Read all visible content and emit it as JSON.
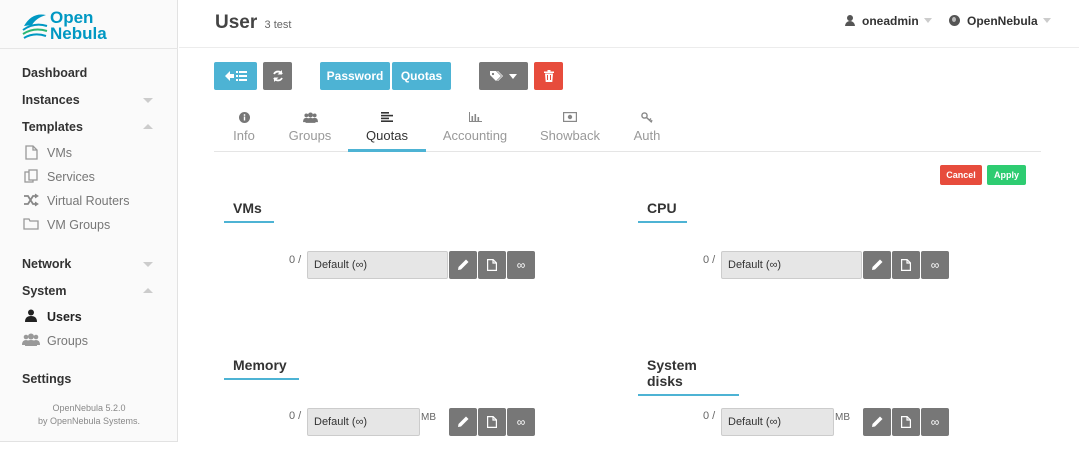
{
  "logo": {
    "line1": "Open",
    "line2": "Nebula"
  },
  "sidebar": {
    "dashboard": "Dashboard",
    "instances": "Instances",
    "templates": "Templates",
    "templates_items": [
      {
        "label": "VMs",
        "icon": "file-icon"
      },
      {
        "label": "Services",
        "icon": "services-icon"
      },
      {
        "label": "Virtual Routers",
        "icon": "shuffle-icon"
      },
      {
        "label": "VM Groups",
        "icon": "folder-icon"
      }
    ],
    "network": "Network",
    "system": "System",
    "system_items": [
      {
        "label": "Users",
        "icon": "user-icon"
      },
      {
        "label": "Groups",
        "icon": "users-icon"
      }
    ],
    "settings": "Settings",
    "footer_version": "OpenNebula 5.2.0",
    "footer_by": "by OpenNebula Systems."
  },
  "header": {
    "title": "User",
    "subtitle": "3 test",
    "user": "oneadmin",
    "zone": "OpenNebula"
  },
  "toolbar": {
    "password": "Password",
    "quotas": "Quotas"
  },
  "tabs": [
    {
      "label": "Info",
      "icon": "info-icon"
    },
    {
      "label": "Groups",
      "icon": "users-icon"
    },
    {
      "label": "Quotas",
      "icon": "align-icon"
    },
    {
      "label": "Accounting",
      "icon": "bar-chart-icon"
    },
    {
      "label": "Showback",
      "icon": "money-icon"
    },
    {
      "label": "Auth",
      "icon": "key-icon"
    }
  ],
  "actions": {
    "cancel": "Cancel",
    "apply": "Apply"
  },
  "quotas": [
    {
      "title": "VMs",
      "used": "0 /",
      "value": "Default (∞)",
      "unit": ""
    },
    {
      "title": "CPU",
      "used": "0 /",
      "value": "Default (∞)",
      "unit": ""
    },
    {
      "title": "Memory",
      "used": "0 /",
      "value": "Default (∞)",
      "unit": "MB"
    },
    {
      "title": "System disks",
      "used": "0 /",
      "value": "Default (∞)",
      "unit": "MB"
    }
  ],
  "quota_buttons": {
    "infinity": "∞"
  },
  "colors": {
    "accent": "#4db3d4",
    "gray": "#777777",
    "danger": "#e74c3c",
    "success": "#2ecc71",
    "brand": "#0098c3"
  }
}
